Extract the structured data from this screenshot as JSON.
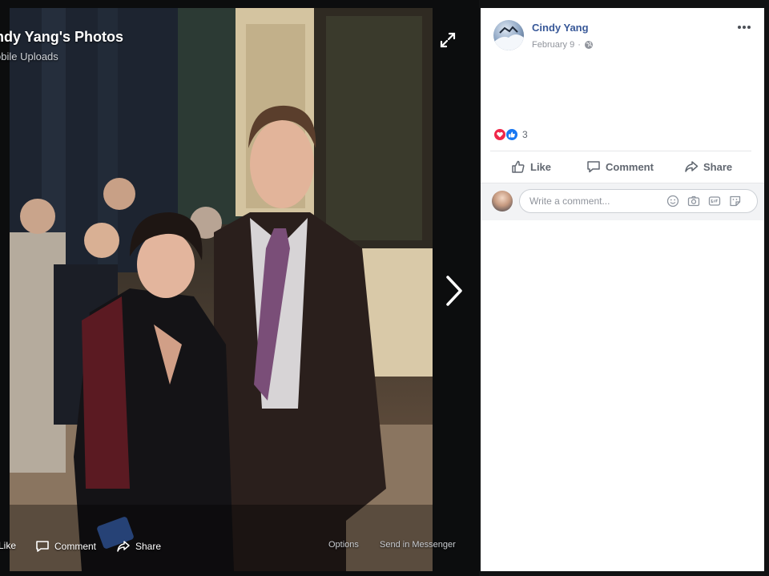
{
  "viewer": {
    "title": "ndy Yang's Photos",
    "subtitle": "obile Uploads",
    "footer": {
      "like_label": "Like",
      "comment_label": "Comment",
      "share_label": "Share",
      "options_label": "Options",
      "send_label": "Send in Messenger"
    }
  },
  "post": {
    "author": "Cindy Yang",
    "date": "February 9",
    "privacy_icon": "globe-icon",
    "reaction_count": "3",
    "reaction_icons": [
      "love-icon",
      "like-icon"
    ],
    "actions": {
      "like_label": "Like",
      "comment_label": "Comment",
      "share_label": "Share"
    },
    "comment": {
      "placeholder": "Write a comment..."
    }
  },
  "colors": {
    "link_blue": "#385898",
    "muted_text": "#616770",
    "panel_bg": "#ffffff",
    "viewer_bg": "#0c0d0e",
    "love_red": "#f0284a",
    "like_blue": "#1877f2"
  }
}
